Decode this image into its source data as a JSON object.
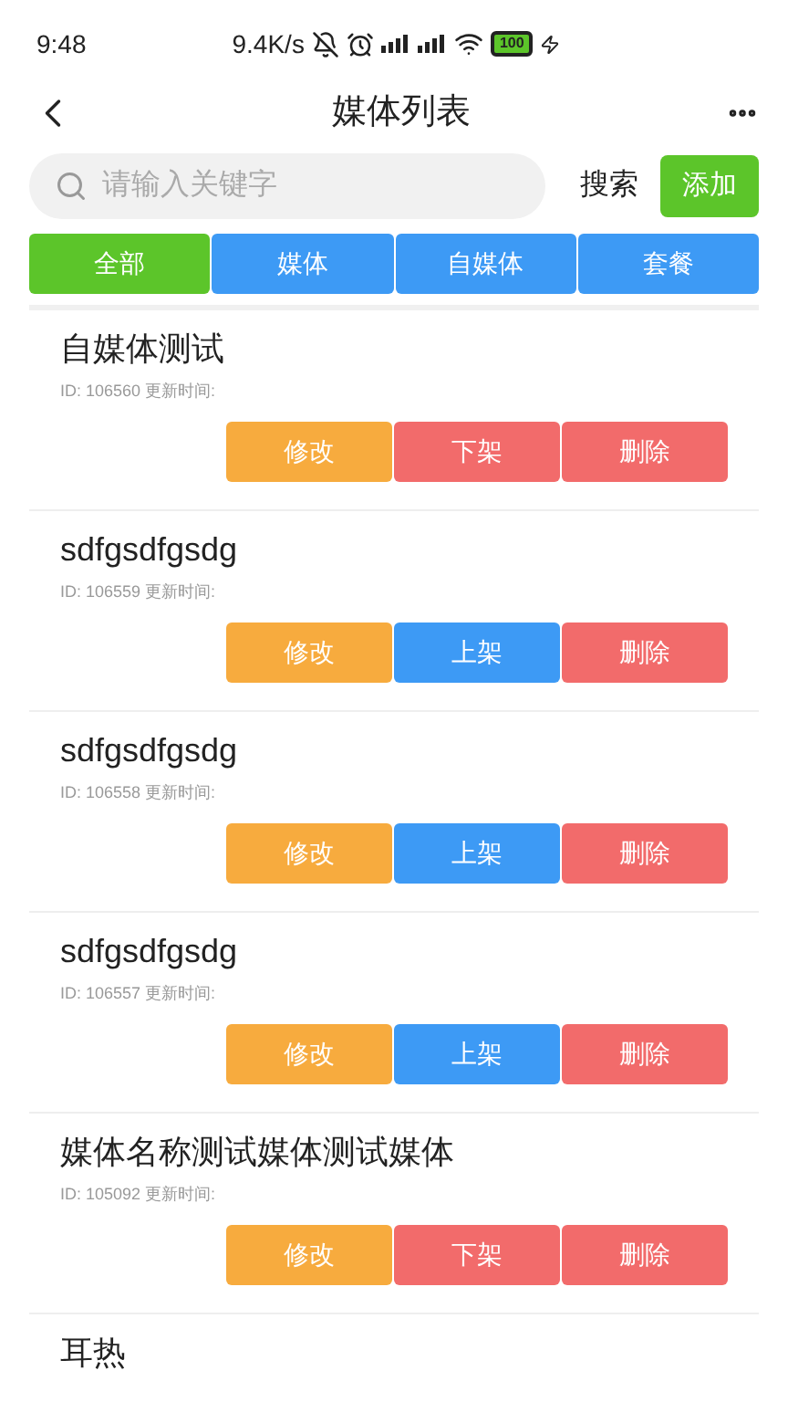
{
  "status_bar": {
    "time": "9:48",
    "speed": "9.4K/s",
    "battery": "100"
  },
  "header": {
    "title": "媒体列表"
  },
  "search": {
    "placeholder": "请输入关键字",
    "search_label": "搜索",
    "add_label": "添加"
  },
  "tabs": [
    {
      "label": "全部",
      "selected": true
    },
    {
      "label": "媒体",
      "selected": false
    },
    {
      "label": "自媒体",
      "selected": false
    },
    {
      "label": "套餐",
      "selected": false
    }
  ],
  "items": [
    {
      "name": "自媒体测试",
      "meta": "ID: 106560 更新时间:",
      "buttons": [
        {
          "label": "修改",
          "kind": "edit"
        },
        {
          "label": "下架",
          "kind": "unlist"
        },
        {
          "label": "删除",
          "kind": "delete"
        }
      ]
    },
    {
      "name": "sdfgsdfgsdg",
      "meta": "ID: 106559 更新时间:",
      "buttons": [
        {
          "label": "修改",
          "kind": "edit"
        },
        {
          "label": "上架",
          "kind": "list"
        },
        {
          "label": "删除",
          "kind": "delete"
        }
      ]
    },
    {
      "name": "sdfgsdfgsdg",
      "meta": "ID: 106558 更新时间:",
      "buttons": [
        {
          "label": "修改",
          "kind": "edit"
        },
        {
          "label": "上架",
          "kind": "list"
        },
        {
          "label": "删除",
          "kind": "delete"
        }
      ]
    },
    {
      "name": "sdfgsdfgsdg",
      "meta": "ID: 106557 更新时间:",
      "buttons": [
        {
          "label": "修改",
          "kind": "edit"
        },
        {
          "label": "上架",
          "kind": "list"
        },
        {
          "label": "删除",
          "kind": "delete"
        }
      ]
    },
    {
      "name": "媒体名称测试媒体测试媒体",
      "meta": "ID: 105092 更新时间:",
      "buttons": [
        {
          "label": "修改",
          "kind": "edit"
        },
        {
          "label": "下架",
          "kind": "unlist"
        },
        {
          "label": "删除",
          "kind": "delete"
        }
      ]
    },
    {
      "name": "耳热"
    }
  ]
}
